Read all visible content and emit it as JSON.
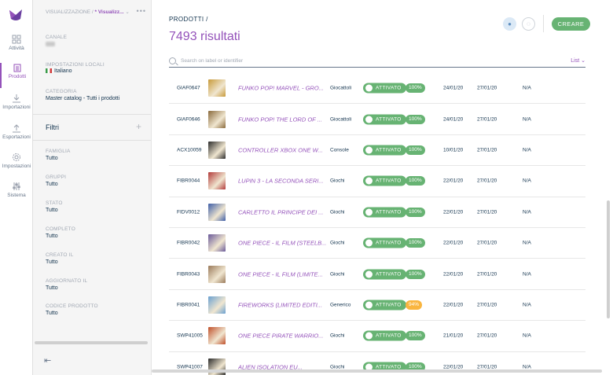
{
  "nav": {
    "items": [
      {
        "label": "Attività",
        "icon": "grid-icon"
      },
      {
        "label": "Prodotti",
        "icon": "clipboard-icon"
      },
      {
        "label": "Importazioni",
        "icon": "download-icon"
      },
      {
        "label": "Esportazioni",
        "icon": "upload-icon"
      },
      {
        "label": "Impostazioni",
        "icon": "gear-icon"
      },
      {
        "label": "Sistema",
        "icon": "sliders-icon"
      }
    ]
  },
  "panel": {
    "view_label": "VISUALIZZAZIONE /",
    "view_value": "* Visualizz...",
    "channel_label": "CANALE",
    "locale_label": "IMPOSTAZIONI LOCALI",
    "locale_value": "Italiano",
    "category_label": "CATEGORIA",
    "category_value": "Master catalog - Tutti i prodotti",
    "filters_title": "Filtri",
    "filters": [
      {
        "label": "FAMIGLIA",
        "value": "Tutto"
      },
      {
        "label": "GRUPPI",
        "value": "Tutto"
      },
      {
        "label": "STATO",
        "value": "Tutto"
      },
      {
        "label": "COMPLETO",
        "value": "Tutto"
      },
      {
        "label": "CREATO IL",
        "value": "Tutto"
      },
      {
        "label": "AGGIORNATO IL",
        "value": "Tutto"
      },
      {
        "label": "CODICE PRODOTTO",
        "value": "Tutto"
      }
    ]
  },
  "header": {
    "breadcrumb": "PRODOTTI /",
    "results": "7493 risultati",
    "create_label": "CREARE"
  },
  "search": {
    "placeholder": "Search on label or identifier",
    "view_mode": "List"
  },
  "colors": {
    "accent": "#9452ba",
    "success": "#67b373",
    "warning": "#f9b53f"
  },
  "rows": [
    {
      "id": "GIAF0647",
      "name": "FUNKO POP! MARVEL - GRO...",
      "family": "Giocattoli",
      "status": "ATTIVATO",
      "complete": "100%",
      "created": "24/01/20",
      "updated": "27/01/20",
      "code": "N/A",
      "thumb": "#c89a3a"
    },
    {
      "id": "GIAF0646",
      "name": "FUNKO POP! THE LORD OF ...",
      "family": "Giocattoli",
      "status": "ATTIVATO",
      "complete": "100%",
      "created": "24/01/20",
      "updated": "27/01/20",
      "code": "N/A",
      "thumb": "#8a6a3c"
    },
    {
      "id": "ACX10059",
      "name": "CONTROLLER XBOX ONE W...",
      "family": "Console",
      "status": "ATTIVATO",
      "complete": "100%",
      "created": "10/01/20",
      "updated": "27/01/20",
      "code": "N/A",
      "thumb": "#2b2b2b"
    },
    {
      "id": "FIBR0044",
      "name": "LUPIN 3 - LA SECONDA SERI...",
      "family": "Giochi",
      "status": "ATTIVATO",
      "complete": "100%",
      "created": "22/01/20",
      "updated": "27/01/20",
      "code": "N/A",
      "thumb": "#b23a3a"
    },
    {
      "id": "FIDV0012",
      "name": "CARLETTO IL PRINCIPE DEI ...",
      "family": "Giochi",
      "status": "ATTIVATO",
      "complete": "100%",
      "created": "22/01/20",
      "updated": "27/01/20",
      "code": "N/A",
      "thumb": "#3f5fa8"
    },
    {
      "id": "FIBR0042",
      "name": "ONE PIECE - IL FILM (STEELB...",
      "family": "Giochi",
      "status": "ATTIVATO",
      "complete": "100%",
      "created": "22/01/20",
      "updated": "27/01/20",
      "code": "N/A",
      "thumb": "#6a5a9a"
    },
    {
      "id": "FIBR0043",
      "name": "ONE PIECE - IL FILM (LIMITE...",
      "family": "Giochi",
      "status": "ATTIVATO",
      "complete": "100%",
      "created": "22/01/20",
      "updated": "27/01/20",
      "code": "N/A",
      "thumb": "#9a7a5a"
    },
    {
      "id": "FIBR0041",
      "name": "FIREWORKS (LIMITED EDITI...",
      "family": "Generico",
      "status": "ATTIVATO",
      "complete": "94%",
      "created": "22/01/20",
      "updated": "27/01/20",
      "code": "N/A",
      "thumb": "#6aa0d0",
      "warn": true
    },
    {
      "id": "SWP41005",
      "name": "ONE PIECE PIRATE WARRIO...",
      "family": "Giochi",
      "status": "ATTIVATO",
      "complete": "100%",
      "created": "21/01/20",
      "updated": "27/01/20",
      "code": "N/A",
      "thumb": "#c0502a"
    },
    {
      "id": "SWP41007",
      "name": "ALIEN ISOLATION EU...",
      "family": "Giochi",
      "status": "ATTIVATO",
      "complete": "100%",
      "created": "22/01/20",
      "updated": "27/01/20",
      "code": "N/A",
      "thumb": "#2a2a2a"
    }
  ]
}
